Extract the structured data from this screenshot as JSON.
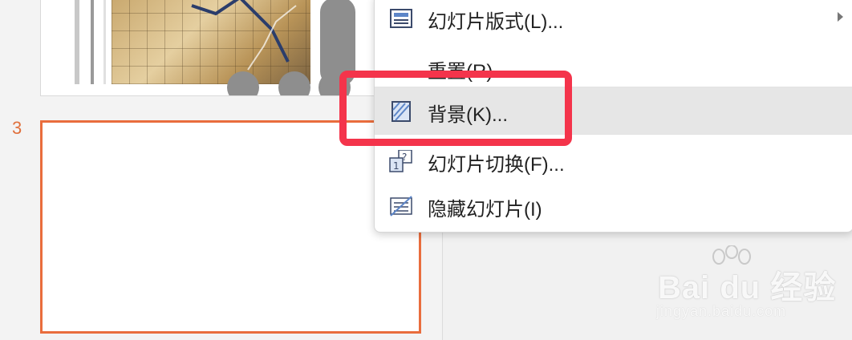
{
  "thumbnails": {
    "slide3_number": "3"
  },
  "context_menu": {
    "items": [
      {
        "label": "幻灯片版式(L)...",
        "icon": "slide-layout-icon",
        "has_submenu": true
      },
      {
        "label": "重置(R)",
        "icon": "none"
      },
      {
        "label": "背景(K)...",
        "icon": "background-icon",
        "highlighted": true
      },
      {
        "label": "幻灯片切换(F)...",
        "icon": "slide-transition-icon"
      },
      {
        "label": "隐藏幻灯片(I)",
        "icon": "hide-slide-icon"
      }
    ]
  },
  "annotation": {
    "color": "#f4344b"
  },
  "watermark": {
    "brand": "Bai du 经验",
    "url": "jingyan.baidu.com"
  },
  "colors": {
    "selection_border": "#e96d3d",
    "slide_number": "#e0703c",
    "menu_highlight": "#e6e6e6"
  }
}
